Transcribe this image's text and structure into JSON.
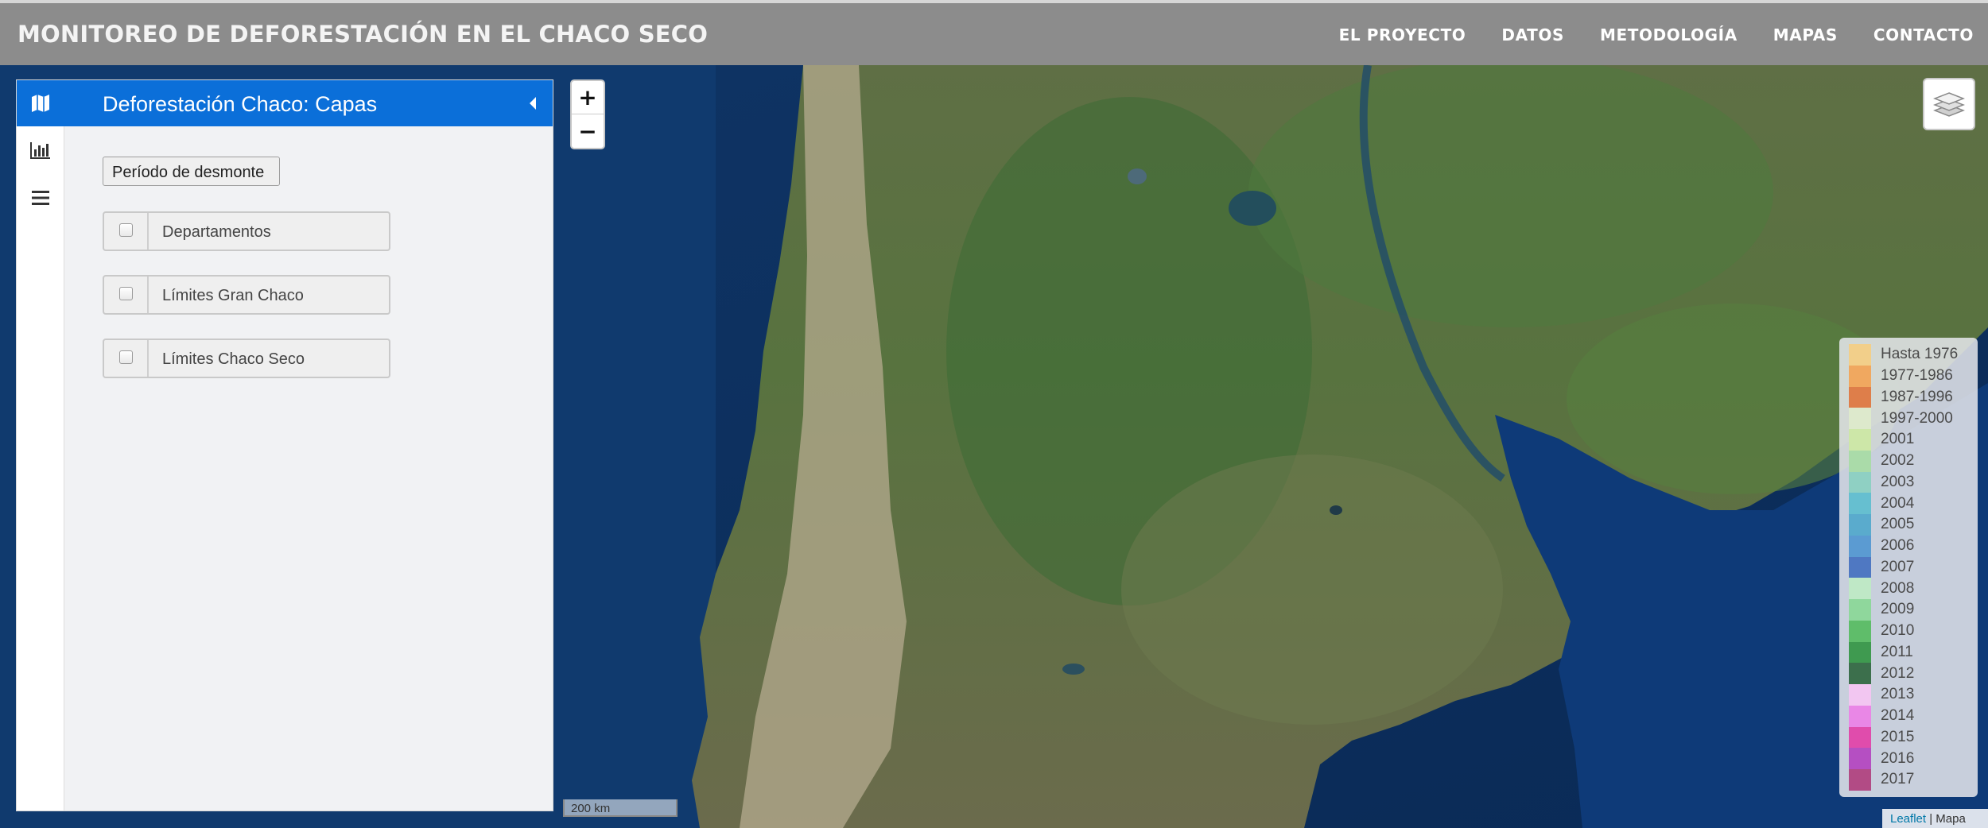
{
  "header": {
    "title": "MONITOREO DE DEFORESTACIÓN EN EL CHACO SECO",
    "nav": [
      "EL PROYECTO",
      "DATOS",
      "METODOLOGÍA",
      "MAPAS",
      "CONTACTO"
    ]
  },
  "sidebar": {
    "tabs": [
      {
        "icon": "map-icon",
        "active": true
      },
      {
        "icon": "bar-chart-icon",
        "active": false
      },
      {
        "icon": "menu-icon",
        "active": false
      }
    ],
    "pane_title": "Deforestación Chaco: Capas",
    "period_button": "Período de desmonte",
    "layers": [
      {
        "label": "Departamentos",
        "checked": false
      },
      {
        "label": "Límites Gran Chaco",
        "checked": false
      },
      {
        "label": "Límites Chaco Seco",
        "checked": false
      }
    ]
  },
  "map": {
    "zoom_in": "+",
    "zoom_out": "−",
    "scale_label": "200 km",
    "attribution": {
      "link": "Leaflet",
      "separator": "|",
      "text": "Mapa"
    }
  },
  "legend": {
    "items": [
      {
        "label": "Hasta 1976",
        "color": "#f2cf8a"
      },
      {
        "label": "1977-1986",
        "color": "#f0a860"
      },
      {
        "label": "1987-1996",
        "color": "#de7e4a"
      },
      {
        "label": "1997-2000",
        "color": "#dde9cc"
      },
      {
        "label": "2001",
        "color": "#cde7a8"
      },
      {
        "label": "2002",
        "color": "#aadba9"
      },
      {
        "label": "2003",
        "color": "#8fd0c3"
      },
      {
        "label": "2004",
        "color": "#66bfd0"
      },
      {
        "label": "2005",
        "color": "#5aabcd"
      },
      {
        "label": "2006",
        "color": "#5b9bd2"
      },
      {
        "label": "2007",
        "color": "#4f78c2"
      },
      {
        "label": "2008",
        "color": "#bfe8c6"
      },
      {
        "label": "2009",
        "color": "#8fd79c"
      },
      {
        "label": "2010",
        "color": "#5fbd6a"
      },
      {
        "label": "2011",
        "color": "#3f9a50"
      },
      {
        "label": "2012",
        "color": "#3c6f4c"
      },
      {
        "label": "2013",
        "color": "#f2c6f1"
      },
      {
        "label": "2014",
        "color": "#e987e6"
      },
      {
        "label": "2015",
        "color": "#e04cac"
      },
      {
        "label": "2016",
        "color": "#b54fc2"
      },
      {
        "label": "2017",
        "color": "#b24b85"
      }
    ]
  }
}
